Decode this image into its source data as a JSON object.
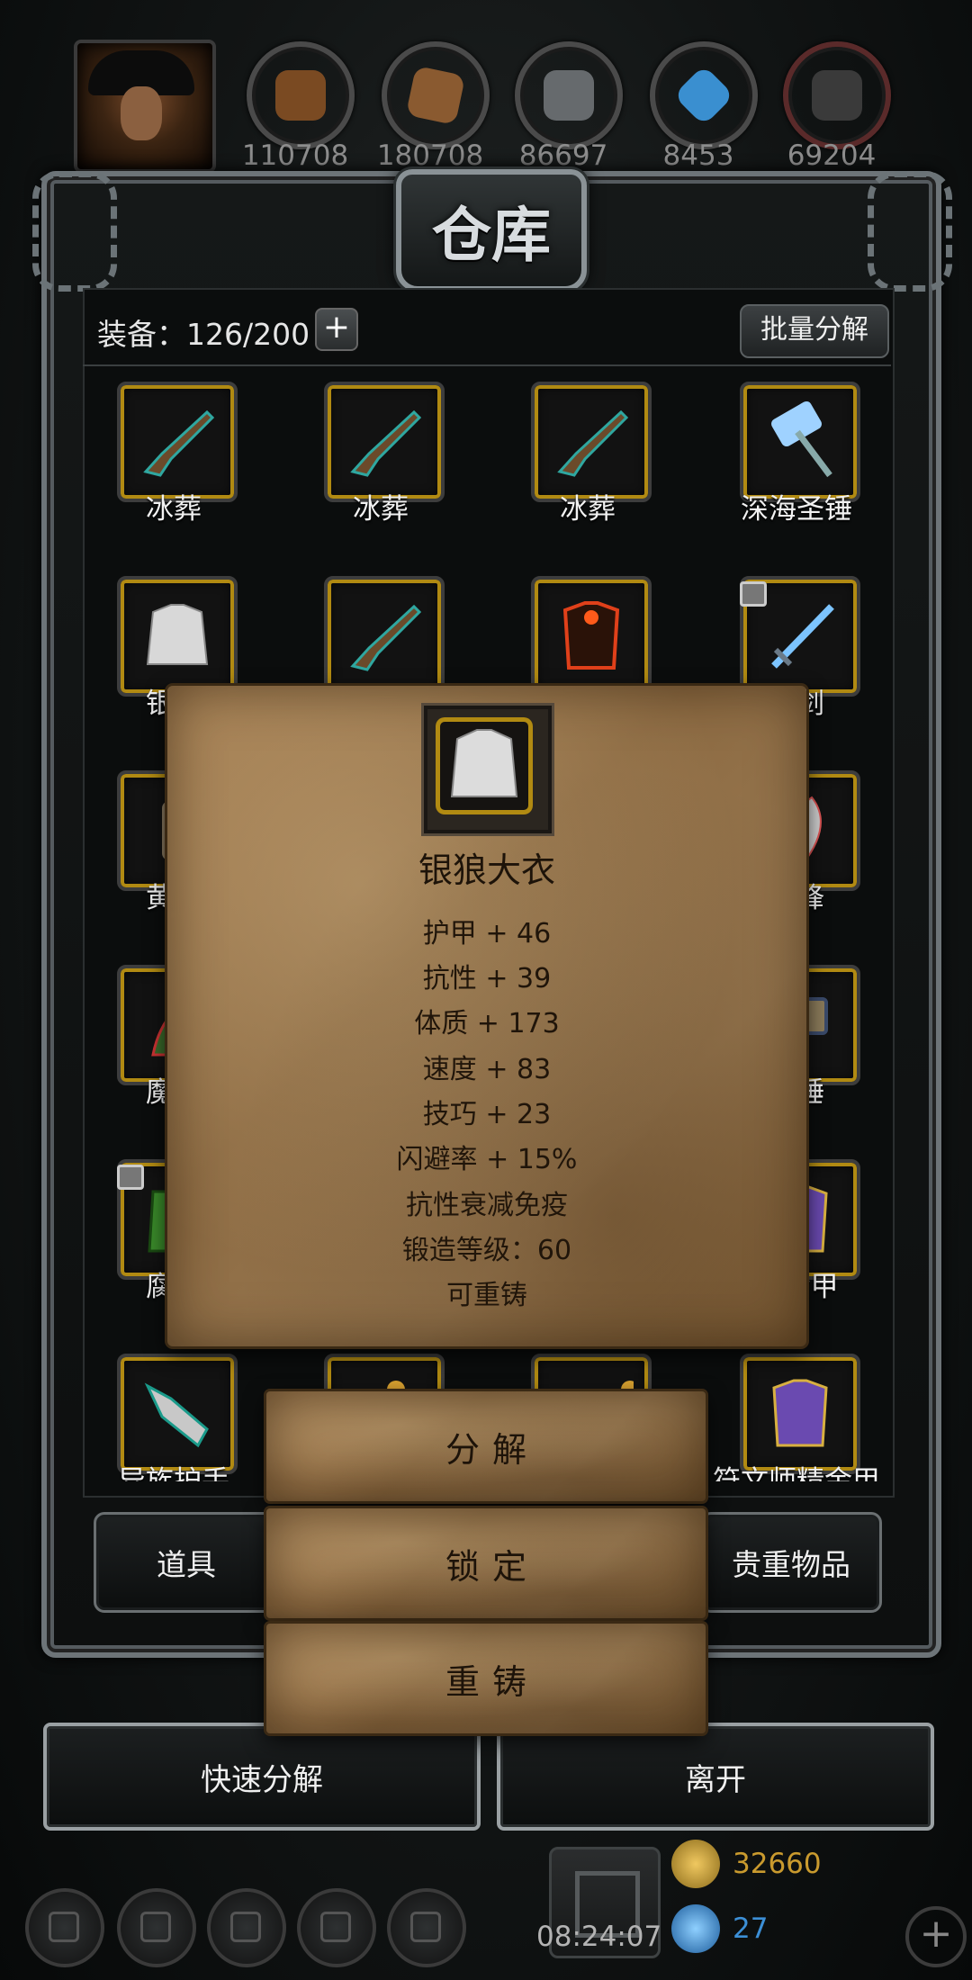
{
  "resources": [
    {
      "icon": "wood-log-icon",
      "value": "110708",
      "color": "#7a4a22"
    },
    {
      "icon": "plank-icon",
      "value": "180708",
      "color": "#8a5a30"
    },
    {
      "icon": "iron-ingot-icon",
      "value": "86697",
      "color": "#666a6d"
    },
    {
      "icon": "crystal-icon",
      "value": "8453",
      "color": "#3a8fd0"
    },
    {
      "icon": "dark-metal-icon",
      "value": "69204",
      "color": "#3a3a3a"
    }
  ],
  "title": "仓库",
  "capacity": {
    "label": "装备：126/200",
    "plus": "+"
  },
  "batch_button": "批量分解",
  "items": [
    {
      "name": "冰葬",
      "icon": "flintlock-pistol-icon"
    },
    {
      "name": "冰葬",
      "icon": "flintlock-pistol-icon"
    },
    {
      "name": "冰葬",
      "icon": "flintlock-pistol-icon"
    },
    {
      "name": "深海圣锤",
      "icon": "ice-hammer-icon"
    },
    {
      "name": "银狼",
      "icon": "fur-coat-icon"
    },
    {
      "name": "",
      "icon": "flintlock-pistol-icon"
    },
    {
      "name": "",
      "icon": "lava-armor-icon"
    },
    {
      "name": "冰剑",
      "icon": "ice-sword-icon",
      "locked": true
    },
    {
      "name": "黄沙",
      "icon": "sand-item-icon"
    },
    {
      "name": "之锋",
      "icon": "blade-icon"
    },
    {
      "name": "魔狼",
      "icon": "demon-wolf-icon"
    },
    {
      "name": "古锤",
      "icon": "ancient-hammer-icon"
    },
    {
      "name": "腐毒",
      "icon": "poison-vest-icon",
      "locked": true
    },
    {
      "name": "精金甲",
      "icon": "purple-armor-icon"
    },
    {
      "name": "异族护手",
      "icon": "gauntlet-icon"
    },
    {
      "name": "",
      "icon": "gold-item-icon"
    },
    {
      "name": "",
      "icon": "gold-item-icon"
    },
    {
      "name": "符文师精金甲",
      "icon": "purple-armor-icon"
    }
  ],
  "tabs": {
    "left": "道具",
    "right": "贵重物品"
  },
  "footer": {
    "quick_dismantle": "快速分解",
    "leave": "离开"
  },
  "status": {
    "time": "08:24:07",
    "gold": "32660",
    "gems": "27",
    "gold_color": "#c99a2e",
    "gem_color": "#3c8fd6"
  },
  "popup": {
    "item_name": "银狼大衣",
    "stats": [
      "护甲 + 46",
      "抗性 + 39",
      "体质 + 173",
      "速度 + 83",
      "技巧 + 23",
      "闪避率 + 15%",
      "抗性衰减免疫",
      "锻造等级：60",
      "可重铸"
    ],
    "actions": {
      "dismantle": "分解",
      "lock": "锁定",
      "reforge": "重铸"
    }
  }
}
